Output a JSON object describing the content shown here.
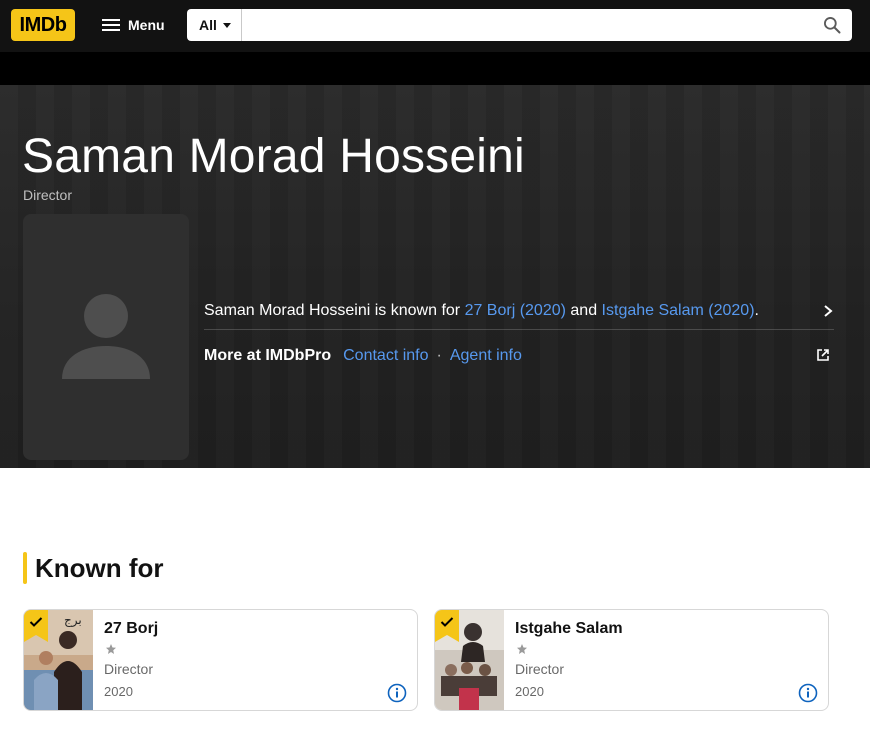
{
  "nav": {
    "logo": "IMDb",
    "menu_label": "Menu",
    "search_category": "All",
    "search_placeholder": ""
  },
  "person": {
    "name": "Saman Morad Hosseini",
    "role": "Director",
    "known_for_prefix": "Saman Morad Hosseini is known for ",
    "known_for_link1": "27 Borj (2020)",
    "known_for_and": " and ",
    "known_for_link2": "Istgahe Salam (2020)",
    "known_for_suffix": "."
  },
  "imdbpro": {
    "label": "More at IMDbPro",
    "contact": "Contact info",
    "separator": "·",
    "agent": "Agent info"
  },
  "known_for": {
    "title": "Known for",
    "items": [
      {
        "title": "27 Borj",
        "role": "Director",
        "year": "2020"
      },
      {
        "title": "Istgahe Salam",
        "role": "Director",
        "year": "2020"
      }
    ]
  },
  "colors": {
    "brand": "#f5c518",
    "link": "#5799ef",
    "hero_bg": "#222222"
  }
}
